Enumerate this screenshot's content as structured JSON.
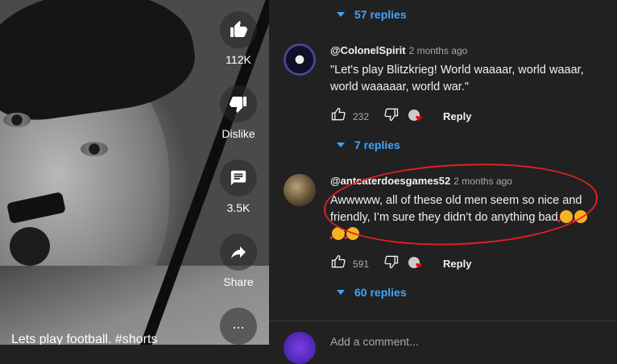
{
  "video": {
    "caption": "Lets play football. #shorts",
    "like_count": "112K",
    "dislike_label": "Dislike",
    "comments_count": "3.5K",
    "share_label": "Share",
    "more_label": "..."
  },
  "comments": {
    "top_replies": "57 replies",
    "items": [
      {
        "handle": "@ColonelSpirit",
        "time": "2 months ago",
        "text": "\"Let's play Blitzkrieg! World waaaar, world waaar, world waaaaar, world war.\"",
        "likes": "232",
        "reply_label": "Reply",
        "replies": "7 replies"
      },
      {
        "handle": "@anteaterdoesgames52",
        "time": "2 months ago",
        "text": "Awwwww, all of these old men seem so nice and friendly, I’m sure they didn’t do anything bad",
        "likes": "591",
        "reply_label": "Reply",
        "replies": "60 replies"
      }
    ],
    "add_placeholder": "Add a comment..."
  },
  "colors": {
    "accent": "#3ea6ff",
    "annotation": "#e02020",
    "background": "#212121"
  }
}
